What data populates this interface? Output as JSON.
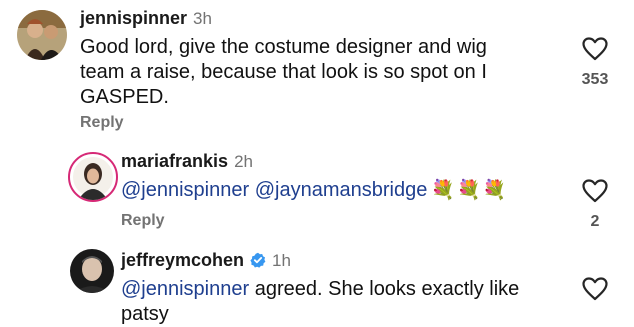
{
  "comments": [
    {
      "username": "jennispinner",
      "time": "3h",
      "text": "Good lord, give the costume designer and wig team a raise, because that look is so spot on I GASPED.",
      "line1": "Good lord, give the costume designer and wig",
      "line2": "team a raise, because that look is so spot on I",
      "line3": "GASPED.",
      "reply_label": "Reply",
      "likes": "353",
      "avatar_icon": "photo-avatar"
    },
    {
      "username": "mariafrankis",
      "time": "2h",
      "mention1": "@jennispinner",
      "mention2": "@jaynamansbridge",
      "emojis": "💐💐💐",
      "reply_label": "Reply",
      "likes": "2",
      "avatar_icon": "photo-avatar"
    },
    {
      "username": "jeffreymcohen",
      "time": "1h",
      "verified": true,
      "mention": "@jennispinner",
      "text_line1": " agreed. She looks exactly like",
      "text_line2": "patsy",
      "avatar_icon": "photo-avatar"
    }
  ],
  "colors": {
    "mention": "#1f3f8f",
    "muted": "#737373",
    "verified": "#3797f0",
    "story_ring": "#d62976"
  }
}
